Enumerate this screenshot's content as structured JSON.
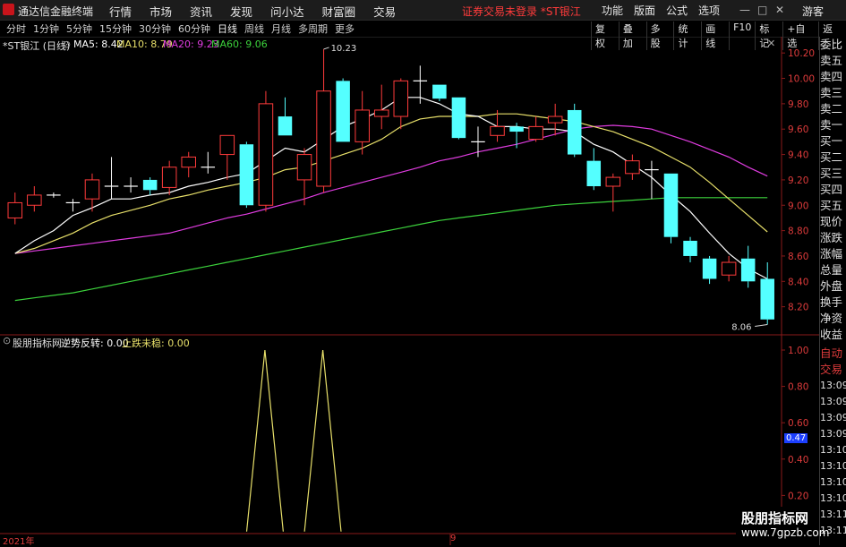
{
  "app": {
    "name": "通达信金融终端",
    "warning": "证券交易未登录 *ST银江",
    "guest": "游客"
  },
  "menu": [
    "行情",
    "市场",
    "资讯",
    "发现",
    "问小达",
    "财富圈",
    "交易"
  ],
  "right_menu": [
    "功能",
    "版面",
    "公式",
    "选项"
  ],
  "window_buttons": [
    "—",
    "□",
    "✕"
  ],
  "periods": [
    "分时",
    "1分钟",
    "5分钟",
    "15分钟",
    "30分钟",
    "60分钟",
    "日线",
    "周线",
    "月线",
    "多周期",
    "更多"
  ],
  "active_period": "日线",
  "tools": [
    "复权",
    "叠加",
    "多股",
    "统计",
    "画线",
    "F10",
    "标记",
    "+自选",
    "返回"
  ],
  "main_chart": {
    "stock_label": "*ST银江 (日线)",
    "ma": [
      {
        "label": "MA5: 8.42",
        "color": "#ffffff"
      },
      {
        "label": "MA10: 8.79",
        "color": "#e8e06a"
      },
      {
        "label": "MA20: 9.23",
        "color": "#e03ce0"
      },
      {
        "label": "MA60: 9.06",
        "color": "#3cd23c"
      }
    ],
    "high_label": "10.23",
    "low_label": "8.06"
  },
  "sub_chart": {
    "title": "股朋指标网",
    "items": [
      {
        "label": "逆势反转: 0.00",
        "color": "#ffffff"
      },
      {
        "label": "止跌未稳: 0.00",
        "color": "#e8e06a"
      }
    ],
    "cursor_value": "0.47"
  },
  "axis": {
    "year_label": "2021年",
    "mid_label": "9"
  },
  "right_panel": [
    "委比",
    "卖五",
    "卖四",
    "卖三",
    "卖二",
    "卖一",
    "买一",
    "买二",
    "买三",
    "买四",
    "买五",
    "现价",
    "涨跌",
    "涨幅",
    "总量",
    "外盘",
    "换手",
    "净资",
    "收益",
    "自动",
    "交易",
    "13:09",
    "13:09",
    "13:09",
    "13:09",
    "13:10",
    "13:10",
    "13:10",
    "13:10",
    "13:11",
    "13:11"
  ],
  "watermark": {
    "line1": "股朋指标网",
    "line2": "www.7gpzb.com"
  },
  "chart_data": [
    {
      "type": "candlestick",
      "title": "*ST银江 (日线)",
      "ylim": [
        8.0,
        10.3
      ],
      "yticks": [
        10.2,
        10.0,
        9.8,
        9.6,
        9.4,
        9.2,
        9.0,
        8.8,
        8.6,
        8.4,
        8.2
      ],
      "candles": [
        {
          "o": 8.9,
          "h": 9.1,
          "l": 8.85,
          "c": 9.02
        },
        {
          "o": 9.0,
          "h": 9.15,
          "l": 8.95,
          "c": 9.08
        },
        {
          "o": 9.08,
          "h": 9.1,
          "l": 9.06,
          "c": 9.08
        },
        {
          "o": 9.02,
          "h": 9.05,
          "l": 8.95,
          "c": 9.02
        },
        {
          "o": 9.05,
          "h": 9.25,
          "l": 8.95,
          "c": 9.2
        },
        {
          "o": 9.15,
          "h": 9.38,
          "l": 9.05,
          "c": 9.15
        },
        {
          "o": 9.15,
          "h": 9.22,
          "l": 9.1,
          "c": 9.15
        },
        {
          "o": 9.2,
          "h": 9.22,
          "l": 9.08,
          "c": 9.12
        },
        {
          "o": 9.14,
          "h": 9.35,
          "l": 9.08,
          "c": 9.3
        },
        {
          "o": 9.3,
          "h": 9.42,
          "l": 9.22,
          "c": 9.38
        },
        {
          "o": 9.3,
          "h": 9.42,
          "l": 9.25,
          "c": 9.3
        },
        {
          "o": 9.4,
          "h": 9.52,
          "l": 9.2,
          "c": 9.55
        },
        {
          "o": 9.48,
          "h": 9.5,
          "l": 8.98,
          "c": 9.0
        },
        {
          "o": 9.0,
          "h": 9.9,
          "l": 8.95,
          "c": 9.8
        },
        {
          "o": 9.7,
          "h": 9.85,
          "l": 9.55,
          "c": 9.55
        },
        {
          "o": 9.2,
          "h": 9.45,
          "l": 9.0,
          "c": 9.4
        },
        {
          "o": 9.15,
          "h": 10.23,
          "l": 9.1,
          "c": 9.9
        },
        {
          "o": 9.98,
          "h": 10.0,
          "l": 9.5,
          "c": 9.5
        },
        {
          "o": 9.5,
          "h": 9.9,
          "l": 9.4,
          "c": 9.75
        },
        {
          "o": 9.7,
          "h": 9.95,
          "l": 9.6,
          "c": 9.75
        },
        {
          "o": 9.7,
          "h": 10.0,
          "l": 9.6,
          "c": 9.98
        },
        {
          "o": 9.98,
          "h": 10.1,
          "l": 9.8,
          "c": 9.98
        },
        {
          "o": 9.95,
          "h": 9.95,
          "l": 9.82,
          "c": 9.84
        },
        {
          "o": 9.85,
          "h": 9.85,
          "l": 9.52,
          "c": 9.53
        },
        {
          "o": 9.5,
          "h": 9.62,
          "l": 9.38,
          "c": 9.5
        },
        {
          "o": 9.55,
          "h": 9.75,
          "l": 9.5,
          "c": 9.62
        },
        {
          "o": 9.62,
          "h": 9.65,
          "l": 9.45,
          "c": 9.58
        },
        {
          "o": 9.52,
          "h": 9.7,
          "l": 9.5,
          "c": 9.62
        },
        {
          "o": 9.65,
          "h": 9.8,
          "l": 9.55,
          "c": 9.7
        },
        {
          "o": 9.75,
          "h": 9.8,
          "l": 9.38,
          "c": 9.4
        },
        {
          "o": 9.35,
          "h": 9.45,
          "l": 9.12,
          "c": 9.15
        },
        {
          "o": 9.15,
          "h": 9.25,
          "l": 8.95,
          "c": 9.22
        },
        {
          "o": 9.25,
          "h": 9.4,
          "l": 9.2,
          "c": 9.35
        },
        {
          "o": 9.28,
          "h": 9.35,
          "l": 9.05,
          "c": 9.28
        },
        {
          "o": 9.25,
          "h": 9.25,
          "l": 8.7,
          "c": 8.75
        },
        {
          "o": 8.72,
          "h": 8.75,
          "l": 8.55,
          "c": 8.6
        },
        {
          "o": 8.58,
          "h": 8.6,
          "l": 8.38,
          "c": 8.42
        },
        {
          "o": 8.45,
          "h": 8.6,
          "l": 8.4,
          "c": 8.55
        },
        {
          "o": 8.58,
          "h": 8.68,
          "l": 8.35,
          "c": 8.4
        },
        {
          "o": 8.42,
          "h": 8.55,
          "l": 8.06,
          "c": 8.1
        }
      ],
      "ma5": [
        8.62,
        8.72,
        8.8,
        8.92,
        8.98,
        9.05,
        9.05,
        9.08,
        9.1,
        9.15,
        9.18,
        9.22,
        9.25,
        9.35,
        9.45,
        9.42,
        9.52,
        9.62,
        9.68,
        9.75,
        9.85,
        9.85,
        9.8,
        9.72,
        9.7,
        9.62,
        9.62,
        9.6,
        9.6,
        9.58,
        9.48,
        9.42,
        9.32,
        9.22,
        9.08,
        8.95,
        8.78,
        8.62,
        8.5,
        8.42
      ],
      "ma10": [
        8.62,
        8.66,
        8.72,
        8.78,
        8.86,
        8.92,
        8.96,
        9.0,
        9.05,
        9.08,
        9.12,
        9.15,
        9.18,
        9.22,
        9.28,
        9.3,
        9.35,
        9.4,
        9.45,
        9.52,
        9.62,
        9.68,
        9.7,
        9.7,
        9.7,
        9.72,
        9.72,
        9.7,
        9.68,
        9.66,
        9.62,
        9.58,
        9.52,
        9.46,
        9.38,
        9.3,
        9.18,
        9.05,
        8.92,
        8.79
      ],
      "ma20": [
        8.62,
        8.64,
        8.66,
        8.68,
        8.7,
        8.72,
        8.74,
        8.76,
        8.78,
        8.82,
        8.86,
        8.9,
        8.93,
        8.97,
        9.01,
        9.05,
        9.1,
        9.14,
        9.18,
        9.22,
        9.26,
        9.3,
        9.35,
        9.38,
        9.42,
        9.45,
        9.48,
        9.52,
        9.56,
        9.6,
        9.62,
        9.63,
        9.62,
        9.6,
        9.55,
        9.5,
        9.44,
        9.38,
        9.3,
        9.23
      ],
      "ma60": [
        8.25,
        8.27,
        8.29,
        8.31,
        8.34,
        8.37,
        8.4,
        8.43,
        8.46,
        8.49,
        8.52,
        8.55,
        8.58,
        8.61,
        8.64,
        8.67,
        8.7,
        8.73,
        8.76,
        8.79,
        8.82,
        8.85,
        8.88,
        8.9,
        8.92,
        8.94,
        8.96,
        8.98,
        9.0,
        9.01,
        9.02,
        9.03,
        9.04,
        9.05,
        9.06,
        9.06,
        9.06,
        9.06,
        9.06,
        9.06
      ]
    },
    {
      "type": "line",
      "title": "股朋指标网",
      "ylim": [
        0,
        1.0
      ],
      "yticks": [
        1.0,
        0.8,
        0.6,
        0.4,
        0.2
      ],
      "series": [
        {
          "name": "逆势反转",
          "values": [
            0,
            0,
            0,
            0,
            0,
            0,
            0,
            0,
            0,
            0,
            0,
            0,
            0,
            0,
            0,
            0,
            0,
            0,
            0,
            0,
            0,
            0,
            0,
            0,
            0,
            0,
            0,
            0,
            0,
            0,
            0,
            0,
            0,
            0,
            0,
            0,
            0,
            0,
            0,
            0
          ]
        },
        {
          "name": "止跌未稳",
          "values": [
            0,
            0,
            0,
            0,
            0,
            0,
            0,
            0,
            0,
            0,
            0,
            0,
            0,
            1,
            0,
            0,
            1,
            0,
            0,
            0,
            0,
            0,
            0,
            0,
            0,
            0,
            0,
            0,
            0,
            0,
            0,
            0,
            0,
            0,
            0,
            0,
            0,
            0,
            0,
            0
          ]
        }
      ]
    }
  ]
}
